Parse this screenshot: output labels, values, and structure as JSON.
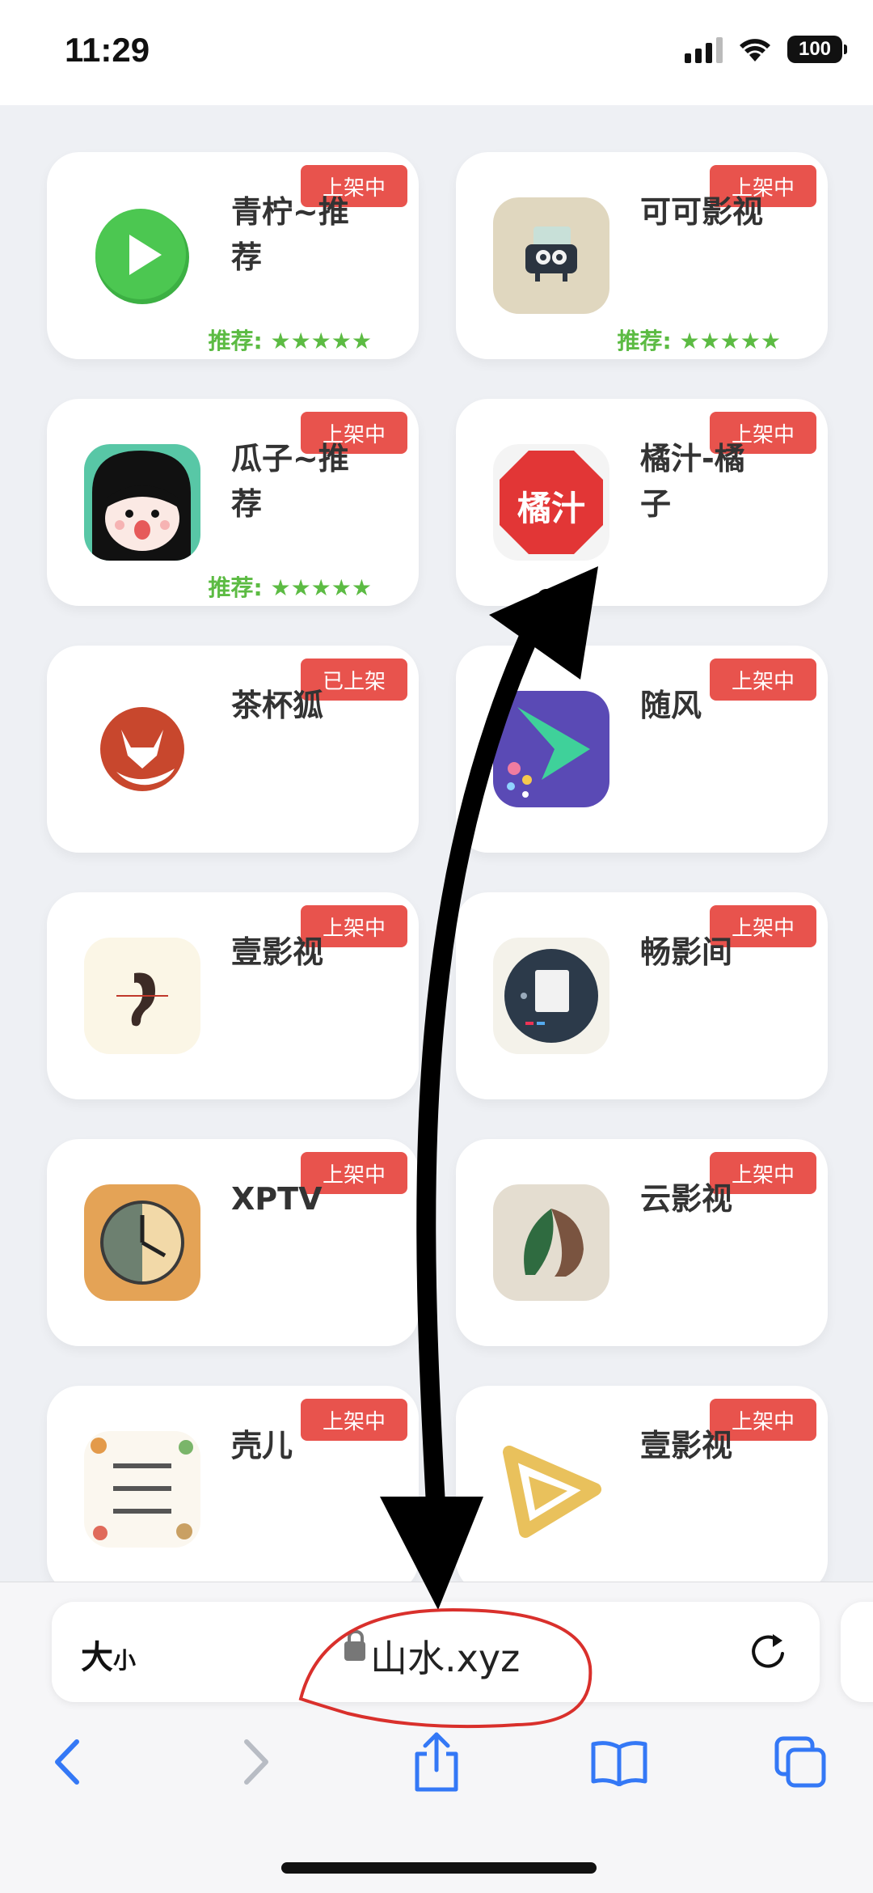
{
  "status_bar": {
    "time": "11:29",
    "battery": "100"
  },
  "apps": [
    {
      "name": "青柠~推荐",
      "badge": "上架中",
      "rating": "推荐: ★★★★★",
      "icon": "green-play-icon"
    },
    {
      "name": "可可影视",
      "badge": "上架中",
      "rating": "推荐: ★★★★★",
      "icon": "retro-tv-icon"
    },
    {
      "name": "瓜子~推荐",
      "badge": "上架中",
      "rating": "推荐: ★★★★★",
      "icon": "cartoon-girl-icon"
    },
    {
      "name": "橘汁-橘子",
      "badge": "上架中",
      "rating": "",
      "icon": "juzhi-stop-sign-icon",
      "icon_text": "橘汁"
    },
    {
      "name": "茶杯狐",
      "badge": "已上架",
      "rating": "",
      "icon": "fox-icon"
    },
    {
      "name": "随风",
      "badge": "上架中",
      "rating": "",
      "icon": "purple-play-icon"
    },
    {
      "name": "壹影视",
      "badge": "上架中",
      "rating": "",
      "icon": "ear-icon"
    },
    {
      "name": "畅影间",
      "badge": "上架中",
      "rating": "",
      "icon": "dark-screen-icon"
    },
    {
      "name": "XPTV",
      "badge": "上架中",
      "rating": "",
      "icon": "clock-icon"
    },
    {
      "name": "云影视",
      "badge": "上架中",
      "rating": "",
      "icon": "leaf-lion-icon"
    },
    {
      "name": "壳儿",
      "badge": "上架中",
      "rating": "",
      "icon": "math-doodle-icon"
    },
    {
      "name": "壹影视",
      "badge": "上架中",
      "rating": "",
      "icon": "film-triangle-icon"
    }
  ],
  "browser": {
    "text_size_label": "大",
    "text_size_small": "小",
    "url": "山水.xyz"
  },
  "colors": {
    "badge": "#e8534d",
    "rating": "#5cbb43",
    "toolbar_blue": "#3478f6",
    "annotation": "#000000",
    "circle": "#d9302c"
  }
}
